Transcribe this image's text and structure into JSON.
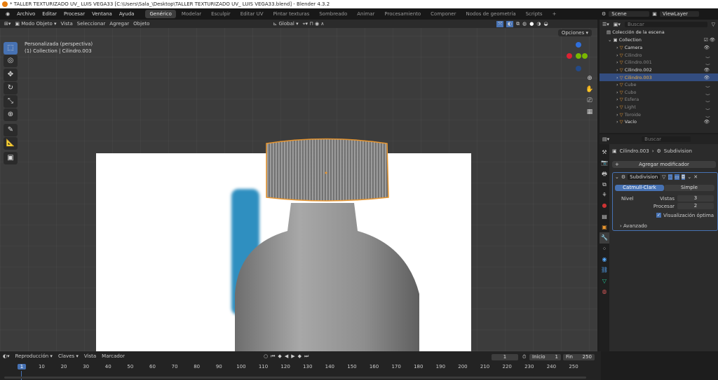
{
  "title": "* TALLER TEXTURIZADO UV_ LUIS VEGA33 [C:\\Users\\Sala_\\Desktop\\TALLER TEXTURIZADO UV_ LUIS VEGA33.blend] - Blender 4.3.2",
  "menu": [
    "Archivo",
    "Editar",
    "Procesar",
    "Ventana",
    "Ayuda"
  ],
  "workspaces": [
    "Genérico",
    "Modelar",
    "Esculpir",
    "Editar UV",
    "Pintar texturas",
    "Sombreado",
    "Animar",
    "Procesamiento",
    "Componer",
    "Nodos de geometría",
    "Scripts"
  ],
  "scene": "Scene",
  "view_layer": "ViewLayer",
  "header": {
    "mode": "Modo Objeto",
    "menus": [
      "Vista",
      "Seleccionar",
      "Agregar",
      "Objeto"
    ],
    "orientation": "Global",
    "options": "Opciones"
  },
  "viewport": {
    "view_name": "Personalizada (perspectiva)",
    "context": "(1) Collection | Cilindro.003"
  },
  "outliner": {
    "search": "Buscar",
    "root": "Colección de la escena",
    "collection": "Collection",
    "items": [
      {
        "name": "Camera",
        "visible": true
      },
      {
        "name": "Cilindro",
        "visible": false
      },
      {
        "name": "Cilindro.001",
        "visible": false
      },
      {
        "name": "Cilindro.002",
        "visible": true
      },
      {
        "name": "Cilindro.003",
        "visible": true,
        "selected": true
      },
      {
        "name": "Cube",
        "visible": false
      },
      {
        "name": "Cubo",
        "visible": false
      },
      {
        "name": "Esfera",
        "visible": false
      },
      {
        "name": "Light",
        "visible": false
      },
      {
        "name": "Toroide",
        "visible": false
      },
      {
        "name": "Vacío",
        "visible": true
      }
    ]
  },
  "properties": {
    "search": "Buscar",
    "object": "Cilindro.003",
    "modifier_crumb": "Subdivision",
    "add_modifier": "Agregar modificador",
    "modifier": {
      "name": "Subdivision",
      "tab_active": "Catmull-Clark",
      "tab_other": "Simple",
      "level_label": "Nivel",
      "viewport_label": "Vistas",
      "viewport_value": "3",
      "render_label": "Procesar",
      "render_value": "2",
      "optimal": "Visualización óptima",
      "advanced": "Avanzado"
    }
  },
  "timeline": {
    "menus": [
      "Reproducción",
      "Claves",
      "Vista",
      "Marcador"
    ],
    "current_frame": "1",
    "start_label": "Inicio",
    "start": "1",
    "end_label": "Fin",
    "end": "250",
    "ticks": [
      "1",
      "10",
      "20",
      "30",
      "40",
      "50",
      "60",
      "70",
      "80",
      "90",
      "100",
      "110",
      "120",
      "130",
      "140",
      "150",
      "160",
      "170",
      "180",
      "190",
      "200",
      "210",
      "220",
      "230",
      "240",
      "250"
    ]
  },
  "colors": {
    "accent": "#4772b3",
    "selected_orange": "#e8a040"
  }
}
